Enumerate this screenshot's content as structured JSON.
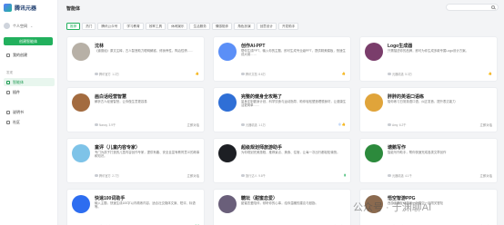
{
  "sidebar": {
    "logo": "腾讯元器",
    "user": "个人空间",
    "user_chevron": "⌄",
    "create_button": "创建智能体",
    "items": [
      {
        "label": "我的创建"
      },
      {
        "label": "智能体"
      },
      {
        "label": "插件"
      },
      {
        "label": "说明书"
      },
      {
        "label": "社区"
      }
    ],
    "section_discover": "发现"
  },
  "main": {
    "title": "智能体",
    "search_placeholder": ""
  },
  "tabs": [
    {
      "label": "推荐",
      "active": true
    },
    {
      "label": "热门"
    },
    {
      "label": "腾讯公众号"
    },
    {
      "label": "学习教育"
    },
    {
      "label": "效率工具"
    },
    {
      "label": "休闲娱乐"
    },
    {
      "label": "生活服务"
    },
    {
      "label": "情感陪伴"
    },
    {
      "label": "角色扮演"
    },
    {
      "label": "创意设计"
    },
    {
      "label": "开发助手"
    }
  ],
  "cards": [
    {
      "title": "沈林",
      "desc": "《道德经》原文注释，古人智慧助力聪明解惑，修身养性，陶冶性情……",
      "author": "腾讯官方",
      "count": "1.2万",
      "action": "👍",
      "action_style": "lg",
      "avatar_color": "#b7b0a6"
    },
    {
      "title": "创作AI-PPT",
      "desc": "帮你生成PPT，输入你的主题，即可生成专业级PPT，提供精美模板，快速生成大纲……",
      "author": "腾讯文档",
      "count": "8.6万",
      "action": "👍",
      "action_style": "lg",
      "avatar_color": "#5b8ff7"
    },
    {
      "title": "Logo生成器",
      "desc": "只需描述你的品牌，即可为你生成多款专属Logo设计方案。",
      "author": "元器精选",
      "count": "5.3万",
      "action": "👍",
      "action_style": "lg",
      "avatar_color": "#7a3d6b"
    },
    {
      "title": "画白话经营智慧",
      "desc": "解析古人经营智慧，让你做生意更容易",
      "author": "Nancy",
      "count": "3.9千",
      "action": "立即对话",
      "action_style": "",
      "avatar_color": "#a36b3f"
    },
    {
      "title": "完整的健身全攻略了",
      "desc": "量身定制健身计划，科学饮食与运动指导，助你轻松塑造理想身材，让健康生活更简单……",
      "author": "元器精选",
      "count": "1.1万",
      "action": "◎ 👍",
      "action_style": "lg",
      "avatar_color": "#2f6fd6"
    },
    {
      "title": "胖胖的英语口语练",
      "desc": "陪你练习日常英语口语，纠正发音，提升表达能力",
      "author": "Amy",
      "count": "6.2千",
      "action": "立即对话",
      "action_style": "",
      "avatar_color": "#e0a43a"
    },
    {
      "title": "童评（儿童内容专家）",
      "desc": "专门为孩子打造的儿童内容创作专家，提供有趣、安全且富有教育意义的故事和知识。",
      "author": "腾讯官方",
      "count": "2.7万",
      "action": "立即对话",
      "action_style": "",
      "avatar_color": "#7ec3e8"
    },
    {
      "title": "超级规划师旅游助手",
      "desc": "为你规划完美旅程，推荐景点、美食、住宿，让每一次出行都轻松愉快。",
      "author": "旅行达人",
      "count": "9.8千",
      "action": "▮",
      "action_style": "gn",
      "avatar_color": "#1d1f24"
    },
    {
      "title": "塘鹅写作",
      "desc": "智能写作助手，帮你快速完成各类文章创作",
      "author": "元器精选",
      "count": "4.1千",
      "action": "立即对话",
      "action_style": "",
      "avatar_color": "#2c8a3c"
    },
    {
      "title": "快速100词助手",
      "desc": "输入主题，快速生成100字以内精炼内容，适合社交媒体文案、短评、标语等。",
      "author": "腾讯官方",
      "count": "7.5千",
      "action": "▮ ▮",
      "action_style": "gn",
      "avatar_color": "#2d6df0"
    },
    {
      "title": "糖坛（甜蜜恋爱）",
      "desc": "甜蜜恋爱陪伴，倾听你的心事，给你温暖的建议与鼓励。",
      "author": "元器精选",
      "count": "2.3万",
      "action": "立即对话",
      "action_style": "",
      "avatar_color": "#6a5f7a"
    },
    {
      "title": "悟空智游PPG",
      "desc": "西游主题互动游戏，与悟空一起闯关冒险",
      "author": "游戏工坊",
      "count": "5.6千",
      "action": "立即对话",
      "action_style": "",
      "avatar_color": "#8b6a4f"
    }
  ],
  "watermark": "公众号 · 于渊聊AI"
}
